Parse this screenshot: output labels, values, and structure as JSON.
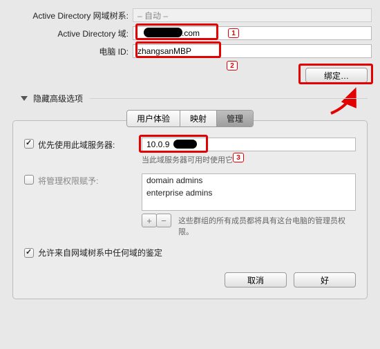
{
  "top": {
    "forest_label": "Active Directory 网域树系:",
    "forest_value": "– 自动 –",
    "domain_label": "Active Directory 域:",
    "domain_value_visible": ".com",
    "computer_label": "电脑 ID:",
    "computer_value": "zhangsanMBP"
  },
  "bind_button": "绑定…",
  "disclosure_label": "隐藏高级选项",
  "tabs": {
    "ux": "用户体验",
    "map": "映射",
    "admin": "管理"
  },
  "pane": {
    "prefer_server_label": "优先使用此域服务器:",
    "prefer_server_value": "10.0.9",
    "prefer_hint": "当此域服务器可用时使用它",
    "grant_admin_label": "将管理权限赋予:",
    "admin_list": [
      "domain admins",
      "enterprise admins"
    ],
    "group_hint": "这些群组的所有成员都将具有这台电脑的管理员权限。",
    "allow_any_label": "允许来自网域树系中任何域的鉴定"
  },
  "buttons": {
    "cancel": "取消",
    "ok": "好"
  },
  "badges": {
    "b1": "1",
    "b2": "2",
    "b3": "3"
  }
}
